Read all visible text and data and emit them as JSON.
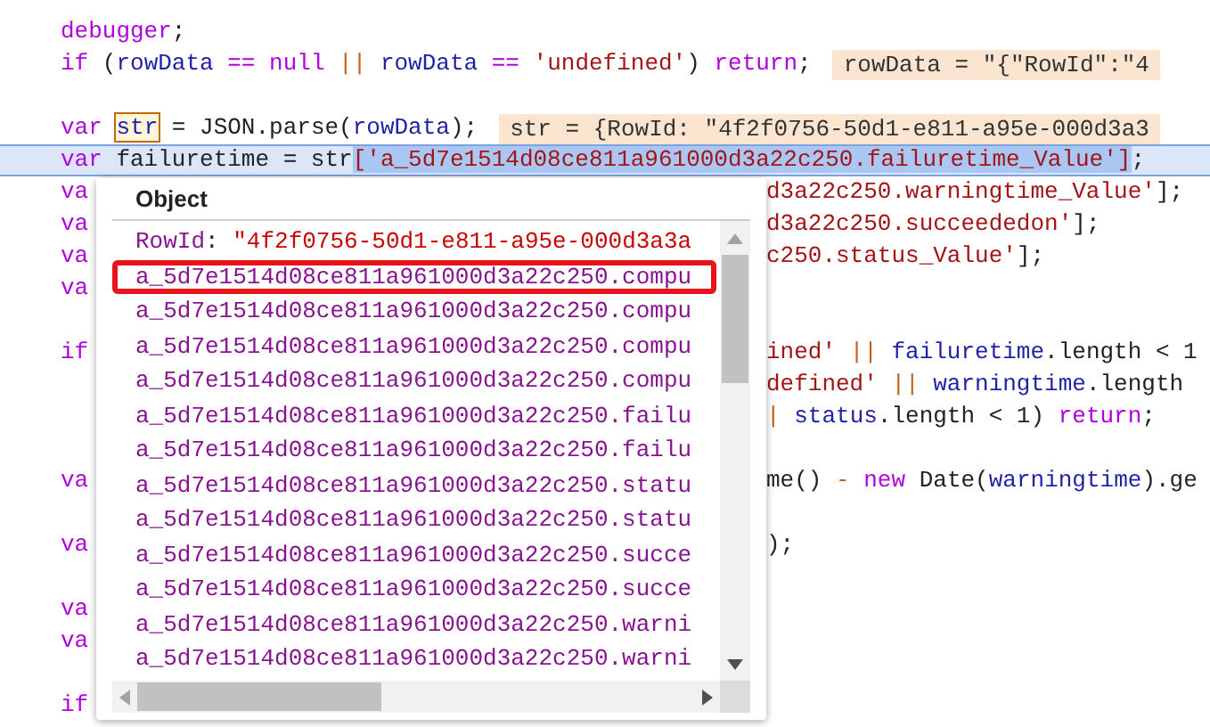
{
  "code_lines": [
    {
      "kind": "code",
      "left": [
        {
          "kind": "kw",
          "text": "debugger"
        },
        {
          "kind": "plain",
          "text": ";"
        }
      ]
    },
    {
      "kind": "code",
      "left": [
        {
          "kind": "kw",
          "text": "if"
        },
        {
          "kind": "plain",
          "text": " ("
        },
        {
          "kind": "id",
          "text": "rowData"
        },
        {
          "kind": "kw",
          "text": " =="
        },
        {
          "kind": "kw",
          "text": " null"
        },
        {
          "kind": "op",
          "text": " ||"
        },
        {
          "kind": "id",
          "text": " rowData"
        },
        {
          "kind": "kw",
          "text": " =="
        },
        {
          "kind": "str",
          "text": " 'undefined'"
        },
        {
          "kind": "plain",
          "text": ")"
        },
        {
          "kind": "kw",
          "text": " return"
        },
        {
          "kind": "plain",
          "text": ";"
        }
      ],
      "hint": "rowData = \"{\"RowId\":\"4"
    },
    {
      "kind": "blank"
    },
    {
      "kind": "code",
      "left": [
        {
          "kind": "kw",
          "text": "var "
        },
        {
          "kind": "hover",
          "text": "str"
        },
        {
          "kind": "plain",
          "text": " = JSON.parse("
        },
        {
          "kind": "id",
          "text": "rowData"
        },
        {
          "kind": "plain",
          "text": ");"
        }
      ],
      "hint": "str = {RowId: \"4f2f0756-50d1-e811-a95e-000d3a3"
    },
    {
      "kind": "code",
      "current": true,
      "left": [
        {
          "kind": "kw",
          "text": "var"
        },
        {
          "kind": "plain",
          "text": " failuretime = str"
        },
        {
          "kind": "sel",
          "text": "['a_5d7e1514d08ce811a961000d3a22c250.failuretime_Value']"
        },
        {
          "kind": "plain",
          "text": ";"
        }
      ]
    },
    {
      "kind": "code",
      "left": [
        {
          "kind": "kw",
          "text": "va"
        }
      ],
      "right": [
        {
          "kind": "str",
          "text": "d3a22c250.warningtime_Value'"
        },
        {
          "kind": "plain",
          "text": "];"
        }
      ]
    },
    {
      "kind": "code",
      "left": [
        {
          "kind": "kw",
          "text": "va"
        }
      ],
      "right": [
        {
          "kind": "str",
          "text": "d3a22c250.succeededon'"
        },
        {
          "kind": "plain",
          "text": "];"
        }
      ]
    },
    {
      "kind": "code",
      "left": [
        {
          "kind": "kw",
          "text": "va"
        }
      ],
      "right": [
        {
          "kind": "str",
          "text": "c250.status_Value'"
        },
        {
          "kind": "plain",
          "text": "];"
        }
      ]
    },
    {
      "kind": "code",
      "left": [
        {
          "kind": "kw",
          "text": "va"
        }
      ]
    },
    {
      "kind": "blank"
    },
    {
      "kind": "code",
      "left": [
        {
          "kind": "kw",
          "text": "if"
        }
      ],
      "right": [
        {
          "kind": "str",
          "text": "ined'"
        },
        {
          "kind": "op",
          "text": " ||"
        },
        {
          "kind": "id",
          "text": " failuretime"
        },
        {
          "kind": "plain",
          "text": ".length < 1"
        }
      ]
    },
    {
      "kind": "code",
      "right": [
        {
          "kind": "str",
          "text": "defined'"
        },
        {
          "kind": "op",
          "text": " ||"
        },
        {
          "kind": "id",
          "text": " warningtime"
        },
        {
          "kind": "plain",
          "text": ".length"
        }
      ]
    },
    {
      "kind": "code",
      "right": [
        {
          "kind": "op",
          "text": "|"
        },
        {
          "kind": "id",
          "text": " status"
        },
        {
          "kind": "plain",
          "text": ".length < 1)"
        },
        {
          "kind": "kw",
          "text": " return"
        },
        {
          "kind": "plain",
          "text": ";"
        }
      ]
    },
    {
      "kind": "blank"
    },
    {
      "kind": "code",
      "left": [
        {
          "kind": "kw",
          "text": "va"
        }
      ],
      "right": [
        {
          "kind": "plain",
          "text": "me()"
        },
        {
          "kind": "op",
          "text": " -"
        },
        {
          "kind": "kw",
          "text": " new"
        },
        {
          "kind": "plain",
          "text": " Date("
        },
        {
          "kind": "id",
          "text": "warningtime"
        },
        {
          "kind": "plain",
          "text": ").ge"
        }
      ]
    },
    {
      "kind": "blank"
    },
    {
      "kind": "code",
      "left": [
        {
          "kind": "kw",
          "text": "va"
        }
      ],
      "right": [
        {
          "kind": "plain",
          "text": ");"
        }
      ]
    },
    {
      "kind": "blank"
    },
    {
      "kind": "code",
      "left": [
        {
          "kind": "kw",
          "text": "va"
        }
      ]
    },
    {
      "kind": "code",
      "left": [
        {
          "kind": "kw",
          "text": "va"
        }
      ]
    },
    {
      "kind": "blank"
    },
    {
      "kind": "code",
      "left": [
        {
          "kind": "kw",
          "text": "if"
        }
      ]
    }
  ],
  "popup": {
    "title": "Object",
    "items": [
      {
        "key": "RowId",
        "separator": ":",
        "value": "\"4f2f0756-50d1-e811-a95e-000d3a3a",
        "selected": false
      },
      {
        "key": "a_5d7e1514d08ce811a961000d3a22c250.compu",
        "selected": true
      },
      {
        "key": "a_5d7e1514d08ce811a961000d3a22c250.compu",
        "selected": false
      },
      {
        "key": "a_5d7e1514d08ce811a961000d3a22c250.compu",
        "selected": false
      },
      {
        "key": "a_5d7e1514d08ce811a961000d3a22c250.compu",
        "selected": false
      },
      {
        "key": "a_5d7e1514d08ce811a961000d3a22c250.failu",
        "selected": false
      },
      {
        "key": "a_5d7e1514d08ce811a961000d3a22c250.failu",
        "selected": false
      },
      {
        "key": "a_5d7e1514d08ce811a961000d3a22c250.statu",
        "selected": false
      },
      {
        "key": "a_5d7e1514d08ce811a961000d3a22c250.statu",
        "selected": false
      },
      {
        "key": "a_5d7e1514d08ce811a961000d3a22c250.succe",
        "selected": false
      },
      {
        "key": "a_5d7e1514d08ce811a961000d3a22c250.succe",
        "selected": false
      },
      {
        "key": "a_5d7e1514d08ce811a961000d3a22c250.warni",
        "selected": false
      },
      {
        "key": "a_5d7e1514d08ce811a961000d3a22c250.warni",
        "selected": false
      }
    ]
  }
}
